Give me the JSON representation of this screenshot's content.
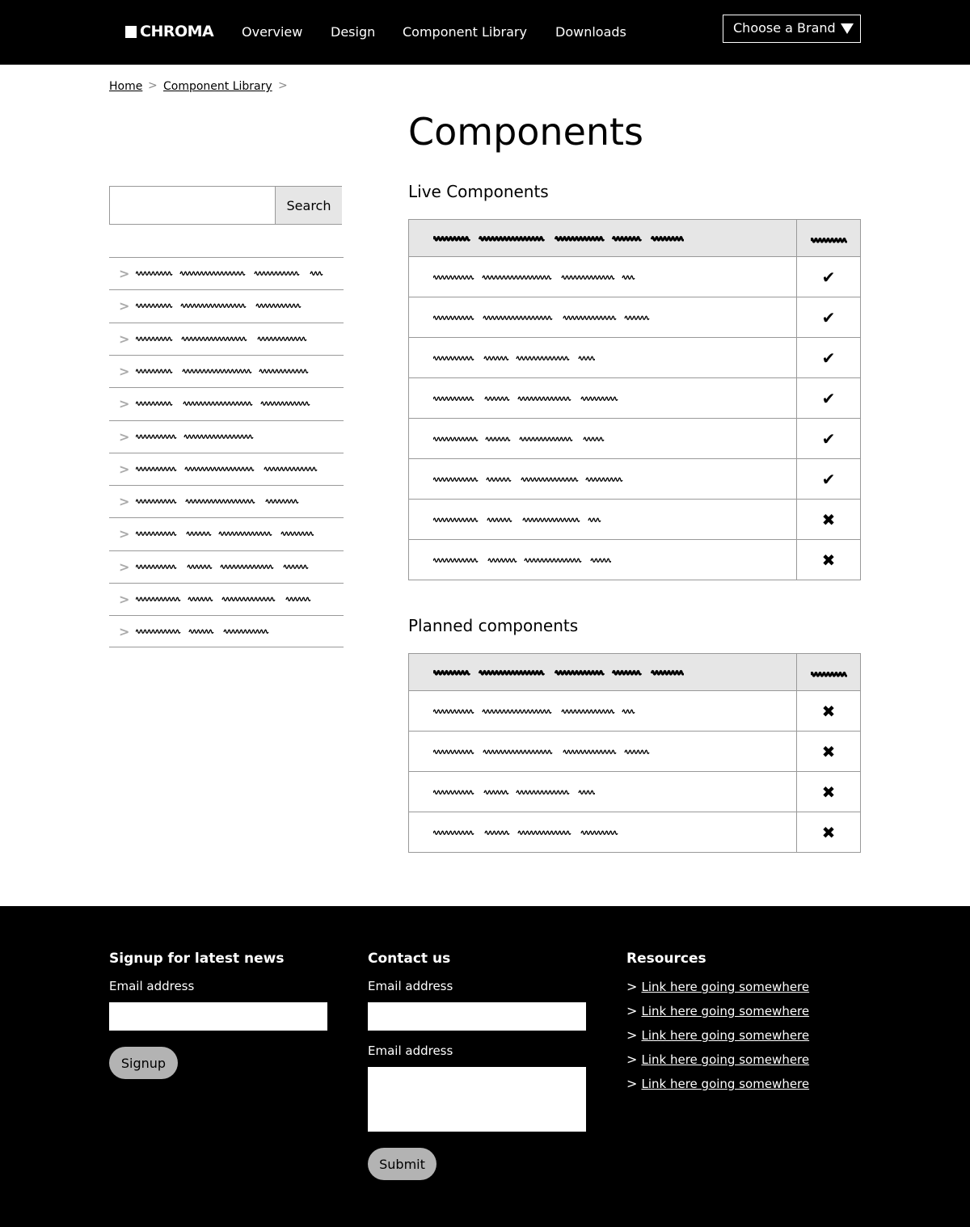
{
  "header": {
    "logo": "CHROMA",
    "nav": [
      "Overview",
      "Design",
      "Component Library",
      "Downloads"
    ],
    "brand_select": "Choose a Brand"
  },
  "breadcrumb": [
    "Home",
    "Component Library"
  ],
  "page_title": "Components",
  "search": {
    "button": "Search",
    "placeholder": ""
  },
  "sidebar": {
    "item_count": 12
  },
  "live": {
    "heading": "Live Components",
    "status": [
      "check",
      "check",
      "check",
      "check",
      "check",
      "check",
      "cross",
      "cross"
    ]
  },
  "planned": {
    "heading": "Planned components",
    "status": [
      "cross",
      "cross",
      "cross",
      "cross"
    ]
  },
  "footer": {
    "signup": {
      "heading": "Signup for latest news",
      "label": "Email address",
      "button": "Signup"
    },
    "contact": {
      "heading": "Contact us",
      "label1": "Email address",
      "label2": "Email address",
      "button": "Submit"
    },
    "resources": {
      "heading": "Resources",
      "links": [
        "Link here going somewhere",
        "Link here going somewhere",
        "Link here going somewhere",
        "Link here going somewhere",
        "Link here going somewhere"
      ]
    }
  }
}
